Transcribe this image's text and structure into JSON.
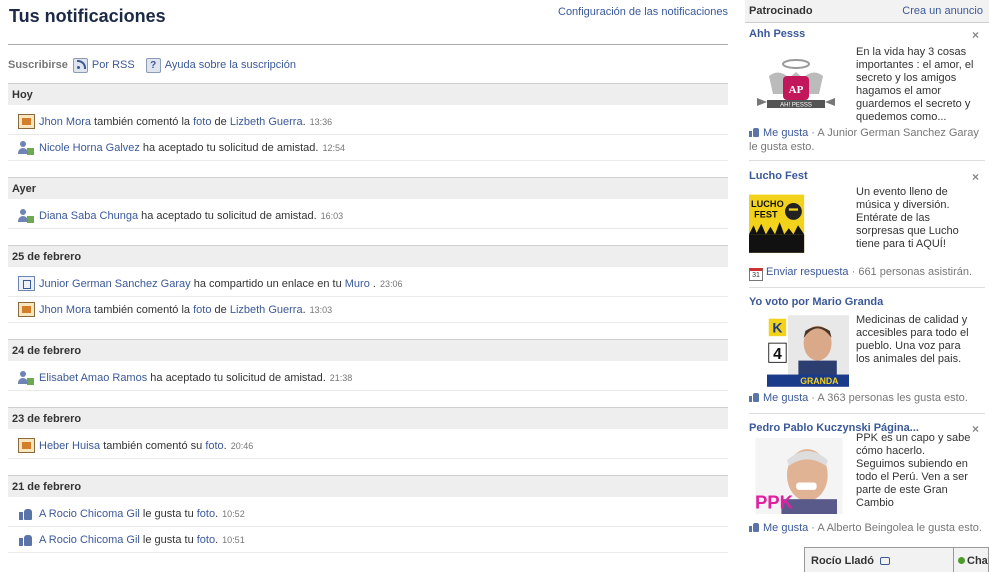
{
  "header": {
    "title": "Tus notificaciones",
    "settings_link": "Configuración de las notificaciones"
  },
  "subscribe": {
    "label": "Suscribirse",
    "rss": "Por RSS",
    "help": "Ayuda sobre la suscripción"
  },
  "sections": [
    {
      "label": "Hoy",
      "items": [
        {
          "icon": "comment",
          "actor": "Jhon Mora",
          "t1": " también comentó la ",
          "l1": "foto",
          "t2": " de ",
          "l2": "Lizbeth Guerra",
          "t3": ".",
          "time": "13:36"
        },
        {
          "icon": "friend",
          "actor": "Nicole Horna Galvez",
          "t1": " ha aceptado tu solicitud de amistad.",
          "l1": "",
          "t2": "",
          "l2": "",
          "t3": "",
          "time": "12:54"
        }
      ]
    },
    {
      "label": "Ayer",
      "items": [
        {
          "icon": "friend",
          "actor": "Diana Saba Chunga",
          "t1": " ha aceptado tu solicitud de amistad.",
          "l1": "",
          "t2": "",
          "l2": "",
          "t3": "",
          "time": "16:03"
        }
      ]
    },
    {
      "label": "25 de febrero",
      "items": [
        {
          "icon": "share",
          "actor": "Junior German Sanchez Garay",
          "t1": " ha compartido un enlace en tu ",
          "l1": "Muro",
          "t2": " .",
          "l2": "",
          "t3": "",
          "time": "23:06"
        },
        {
          "icon": "comment",
          "actor": "Jhon Mora",
          "t1": " también comentó la ",
          "l1": "foto",
          "t2": " de ",
          "l2": "Lizbeth Guerra",
          "t3": ".",
          "time": "13:03"
        }
      ]
    },
    {
      "label": "24 de febrero",
      "items": [
        {
          "icon": "friend",
          "actor": "Elisabet Amao Ramos",
          "t1": " ha aceptado tu solicitud de amistad.",
          "l1": "",
          "t2": "",
          "l2": "",
          "t3": "",
          "time": "21:38"
        }
      ]
    },
    {
      "label": "23 de febrero",
      "items": [
        {
          "icon": "comment",
          "actor": "Heber Huisa",
          "t1": " también comentó su ",
          "l1": "foto",
          "t2": ".",
          "l2": "",
          "t3": "",
          "time": "20:46"
        }
      ]
    },
    {
      "label": "21 de febrero",
      "items": [
        {
          "icon": "like",
          "actor": "A Rocio Chicoma Gil",
          "t1": " le gusta tu ",
          "l1": "foto",
          "t2": ".",
          "l2": "",
          "t3": "",
          "time": "10:52"
        },
        {
          "icon": "like",
          "actor": "A Rocio Chicoma Gil",
          "t1": " le gusta tu ",
          "l1": "foto",
          "t2": ".",
          "l2": "",
          "t3": "",
          "time": "10:51"
        }
      ]
    }
  ],
  "sidebar": {
    "title": "Patrocinado",
    "create_ad": "Crea un anuncio",
    "ads": [
      {
        "title": "Ahh Pesss",
        "text": "En la vida hay 3 cosas importantes : el amor, el secreto y los amigos hagamos el amor guardemos el secreto y quedemos como...",
        "action": "Me gusta",
        "social": " · A Junior German Sanchez Garay le gusta esto.",
        "img_text": "AH! PESSS"
      },
      {
        "title": "Lucho Fest",
        "text": "Un evento lleno de música y diversión. Entérate de las sorpresas que Lucho tiene para ti AQUÍ!",
        "action": "Enviar respuesta",
        "social": " · 661 personas asistirán.",
        "img_text": "LUCHO FEST",
        "cal": "31"
      },
      {
        "title": "Yo voto por Mario Granda",
        "text": "Medicinas de calidad y accesibles para todo el pueblo. Una voz para los animales del pais.",
        "action": "Me gusta",
        "social": " · A 363 personas les gusta esto.",
        "img_text": "GRANDA",
        "img_num": "4"
      },
      {
        "title": "Pedro Pablo Kuczynski Página...",
        "text": "PPK es un capo y sabe cómo hacerlo. Seguimos subiendo en todo el Perú. Ven a ser parte de este Gran Cambio",
        "action": "Me gusta",
        "social": " · A Alberto Beingolea le gusta esto.",
        "img_text": "PPK"
      }
    ]
  },
  "chat": {
    "user": "Rocío Lladó",
    "chat_label": "Chat"
  },
  "colors": {
    "link": "#3b5998",
    "header_bg": "#eeeeee"
  }
}
